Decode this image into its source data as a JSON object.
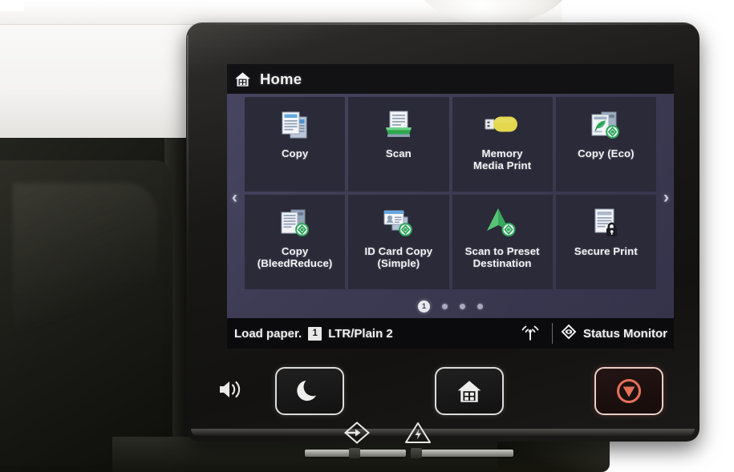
{
  "device": {
    "type": "multifunction-printer-control-panel"
  },
  "screen": {
    "header": {
      "icon": "home-icon",
      "title": "Home"
    },
    "nav": {
      "prev": "‹",
      "prev_icon": "chevron-left-icon",
      "next": "›",
      "next_icon": "chevron-right-icon"
    },
    "tiles": [
      {
        "id": "copy",
        "label": "Copy",
        "icon": "copy-documents-icon",
        "label_lines": [
          "Copy"
        ]
      },
      {
        "id": "scan",
        "label": "Scan",
        "icon": "scanner-icon",
        "label_lines": [
          "Scan"
        ]
      },
      {
        "id": "memory-media-print",
        "label": "Memory Media Print",
        "icon": "usb-drive-icon",
        "label_lines": [
          "Memory",
          "Media Print"
        ]
      },
      {
        "id": "copy-eco",
        "label": "Copy (Eco)",
        "icon": "copy-eco-icon",
        "label_lines": [
          "Copy (Eco)"
        ]
      },
      {
        "id": "copy-bleedreduce",
        "label": "Copy (BleedReduce)",
        "icon": "copy-bleedreduce-icon",
        "label_lines": [
          "Copy",
          "(BleedReduce)"
        ]
      },
      {
        "id": "id-card-copy",
        "label": "ID Card Copy (Simple)",
        "icon": "id-card-copy-icon",
        "label_lines": [
          "ID Card Copy",
          "(Simple)"
        ]
      },
      {
        "id": "scan-to-preset",
        "label": "Scan to Preset Destination",
        "icon": "scan-to-preset-icon",
        "label_lines": [
          "Scan to Preset",
          "Destination"
        ]
      },
      {
        "id": "secure-print",
        "label": "Secure Print",
        "icon": "secure-print-lock-icon",
        "label_lines": [
          "Secure Print"
        ]
      }
    ],
    "pagination": {
      "total_pages": 4,
      "current_page": 1,
      "current_label": "1"
    },
    "status_bar": {
      "message": "Load paper.",
      "tray_number": "1",
      "paper_info": "LTR/Plain 2",
      "wifi_icon": "wifi-icon",
      "status_monitor_icon": "status-monitor-diamond-icon",
      "status_monitor_label": "Status Monitor"
    }
  },
  "hardware": {
    "speaker_icon": "speaker-volume-icon",
    "buttons": [
      {
        "id": "sleep",
        "icon": "moon-sleep-icon",
        "label": "Energy Saver"
      },
      {
        "id": "home",
        "icon": "home-house-icon",
        "label": "Home"
      },
      {
        "id": "stop",
        "icon": "stop-circle-icon",
        "label": "Stop"
      }
    ],
    "indicators": [
      {
        "id": "data",
        "icon": "data-arrow-icon",
        "label": "Data"
      },
      {
        "id": "error",
        "icon": "error-triangle-icon",
        "label": "Error"
      }
    ]
  },
  "colors": {
    "screen_bg": "#3d3b53",
    "tile_bg": "#2b2a38",
    "header_bg": "#121214",
    "status_bg": "#0b0b0d",
    "eco_green": "#27a05a",
    "usb_yellow": "#e5d84f",
    "stop_red": "#e2705c",
    "text_light": "#f2f2f2"
  }
}
